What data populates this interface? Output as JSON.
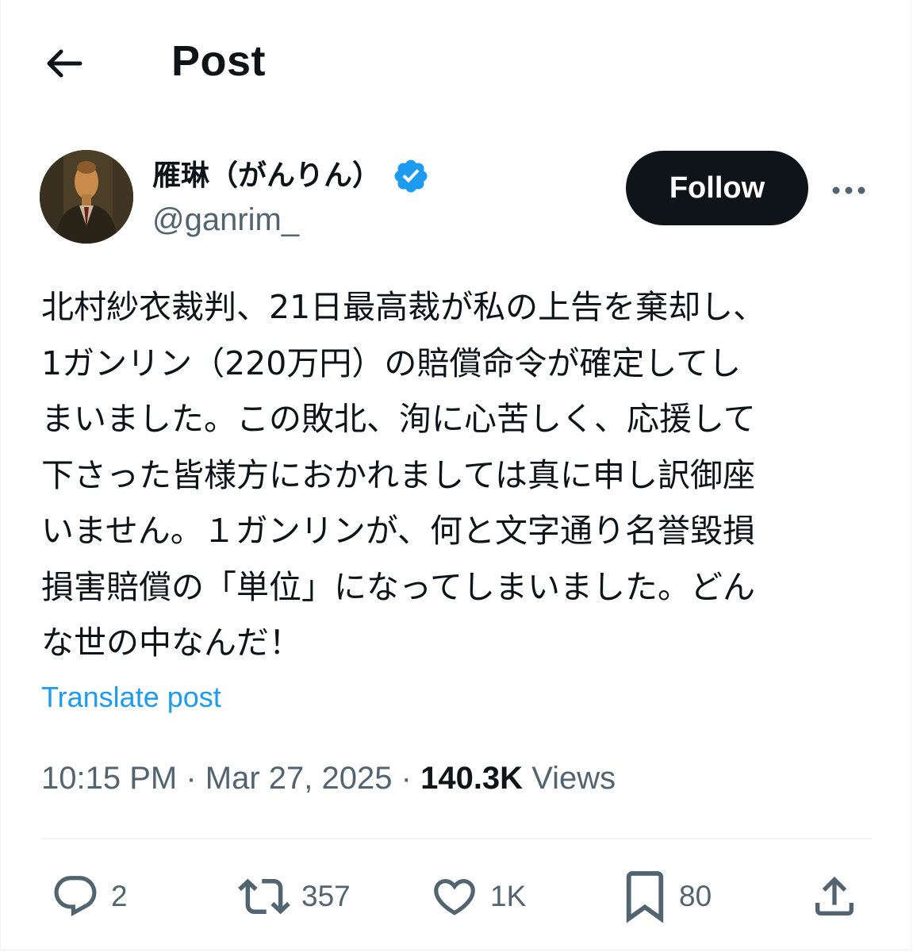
{
  "header": {
    "title": "Post"
  },
  "author": {
    "display_name": "雁琳（がんりん）",
    "handle": "@ganrim_",
    "verified": true,
    "follow_label": "Follow"
  },
  "post": {
    "lines": [
      "北村紗衣裁判、21日最高裁が私の上告を棄却し、",
      "1ガンリン（220万円）の賠償命令が確定してし",
      "まいました。この敗北、洵に心苦しく、応援して",
      "下さった皆様方におかれましては真に申し訳御座",
      "いません。１ガンリンが、何と文字通り名誉毀損",
      "損害賠償の「単位」になってしまいました。どん",
      "な世の中なんだ！"
    ],
    "translate_label": "Translate post",
    "time": "10:15 PM",
    "separator": "·",
    "date": "Mar 27, 2025",
    "views_count": "140.3K",
    "views_label": "Views"
  },
  "actions": {
    "replies": "2",
    "reposts": "357",
    "likes": "1K",
    "bookmarks": "80"
  },
  "colors": {
    "text_primary": "#0f1419",
    "text_secondary": "#536471",
    "link": "#1d9bf0",
    "verified_badge": "#1d9bf0",
    "follow_bg": "#0f1419",
    "divider": "#eff3f4"
  },
  "icons": {
    "back": "arrow-left-icon",
    "verified": "verified-badge-icon",
    "more": "more-dots-icon",
    "reply": "reply-icon",
    "repost": "repost-icon",
    "like": "heart-icon",
    "bookmark": "bookmark-icon",
    "share": "share-icon"
  }
}
